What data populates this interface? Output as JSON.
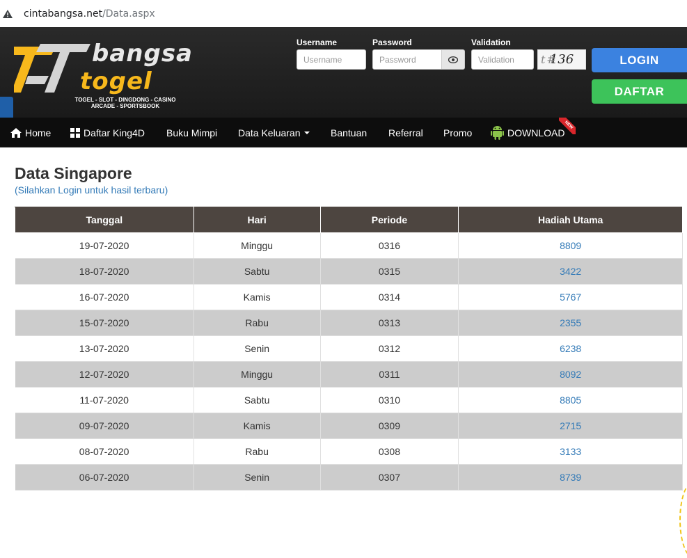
{
  "browser": {
    "url_host": "cintabangsa.net",
    "url_path": "/Data.aspx"
  },
  "logo": {
    "word1": "bangsa",
    "word2": "togel",
    "tagline1": "TOGEL - SLOT - DINGDONG - CASINO",
    "tagline2": "ARCADE - SPORTSBOOK"
  },
  "login_form": {
    "username_label": "Username",
    "username_placeholder": "Username",
    "password_label": "Password",
    "password_placeholder": "Password",
    "validation_label": "Validation",
    "validation_placeholder": "Validation",
    "captcha_text": "136",
    "login_button": "LOGIN",
    "register_button": "DAFTAR"
  },
  "nav": {
    "home": "Home",
    "daftar_king4d": "Daftar King4D",
    "buku_mimpi": "Buku Mimpi",
    "data_keluaran": "Data Keluaran",
    "bantuan": "Bantuan",
    "referral": "Referral",
    "promo": "Promo",
    "download": "DOWNLOAD",
    "new_badge": "NEW"
  },
  "page": {
    "title": "Data Singapore",
    "subtitle": "(Silahkan Login untuk hasil terbaru)"
  },
  "table": {
    "headers": [
      "Tanggal",
      "Hari",
      "Periode",
      "Hadiah Utama"
    ],
    "rows": [
      [
        "19-07-2020",
        "Minggu",
        "0316",
        "8809"
      ],
      [
        "18-07-2020",
        "Sabtu",
        "0315",
        "3422"
      ],
      [
        "16-07-2020",
        "Kamis",
        "0314",
        "5767"
      ],
      [
        "15-07-2020",
        "Rabu",
        "0313",
        "2355"
      ],
      [
        "13-07-2020",
        "Senin",
        "0312",
        "6238"
      ],
      [
        "12-07-2020",
        "Minggu",
        "0311",
        "8092"
      ],
      [
        "11-07-2020",
        "Sabtu",
        "0310",
        "8805"
      ],
      [
        "09-07-2020",
        "Kamis",
        "0309",
        "2715"
      ],
      [
        "08-07-2020",
        "Rabu",
        "0308",
        "3133"
      ],
      [
        "06-07-2020",
        "Senin",
        "0307",
        "8739"
      ]
    ]
  },
  "colors": {
    "login_blue": "#3b82e0",
    "daftar_green": "#3dc35a",
    "logo_yellow": "#f7b81c",
    "table_header": "#4d4540",
    "link_blue": "#337ab7"
  }
}
